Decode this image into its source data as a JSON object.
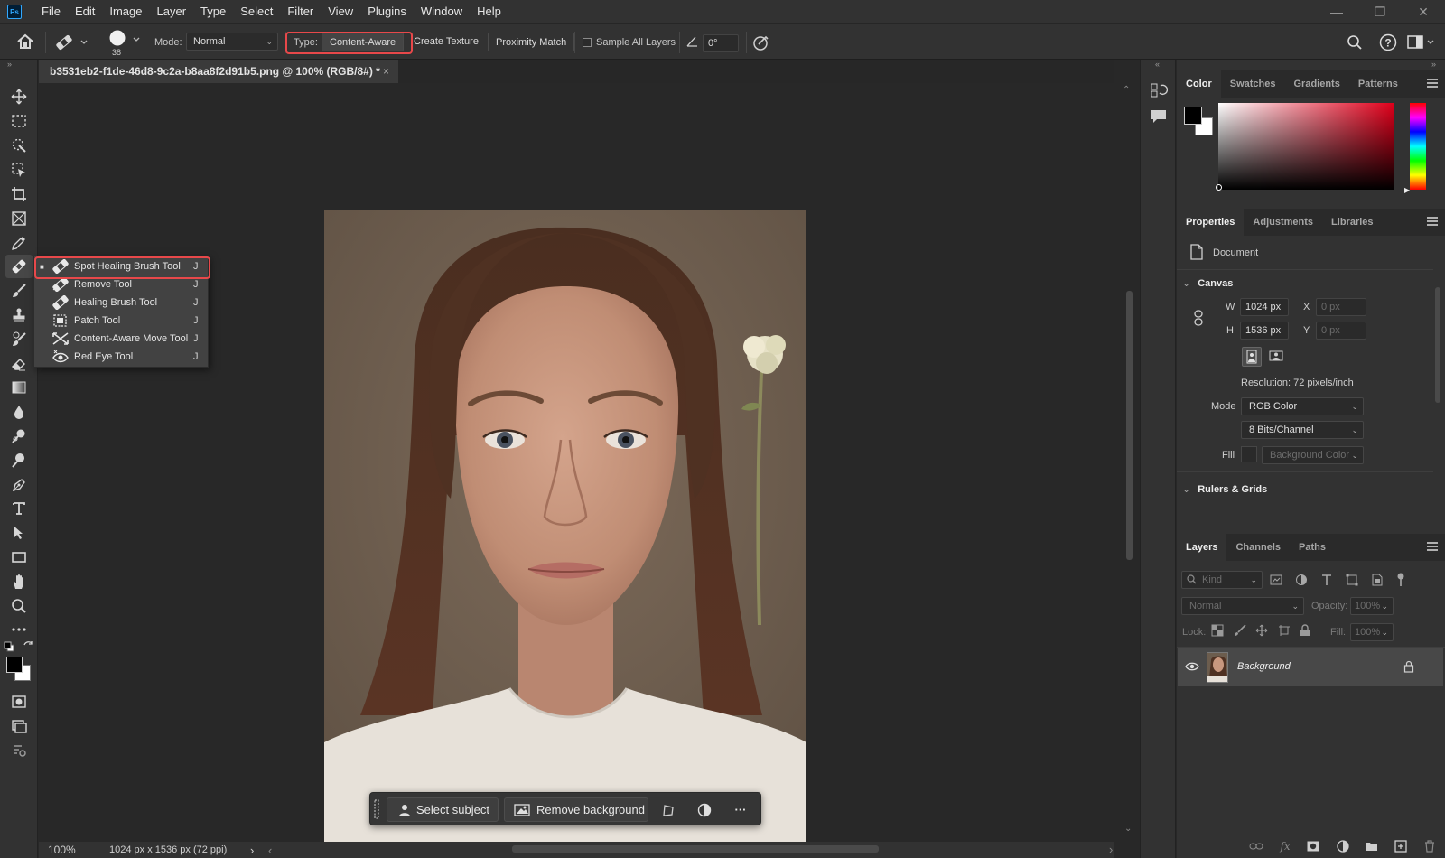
{
  "app": {
    "logo": "Ps"
  },
  "menu": [
    "File",
    "Edit",
    "Image",
    "Layer",
    "Type",
    "Select",
    "Filter",
    "View",
    "Plugins",
    "Window",
    "Help"
  ],
  "window_controls": {
    "minimize": "—",
    "restore": "❐",
    "close": "✕"
  },
  "options": {
    "brush_size": "38",
    "mode_label": "Mode:",
    "mode_value": "Normal",
    "type_label": "Type:",
    "type_content_aware": "Content-Aware",
    "type_create_texture": "Create Texture",
    "type_proximity_match": "Proximity Match",
    "sample_all_layers": "Sample All Layers",
    "angle_value": "0°"
  },
  "document": {
    "tab_title": "b3531eb2-f1de-46d8-9c2a-b8aa8f2d91b5.png @ 100% (RGB/8#) *",
    "close": "×"
  },
  "flyout": {
    "items": [
      {
        "label": "Spot Healing Brush Tool",
        "key": "J",
        "icon": "spot-healing-brush-icon",
        "active": true
      },
      {
        "label": "Remove Tool",
        "key": "J",
        "icon": "remove-tool-icon",
        "active": false
      },
      {
        "label": "Healing Brush Tool",
        "key": "J",
        "icon": "healing-brush-icon",
        "active": false
      },
      {
        "label": "Patch Tool",
        "key": "J",
        "icon": "patch-tool-icon",
        "active": false
      },
      {
        "label": "Content-Aware Move Tool",
        "key": "J",
        "icon": "content-aware-move-icon",
        "active": false
      },
      {
        "label": "Red Eye Tool",
        "key": "J",
        "icon": "red-eye-icon",
        "active": false
      }
    ],
    "active_marker": "■"
  },
  "taskbar": {
    "select_subject": "Select subject",
    "remove_background": "Remove background",
    "more": "···"
  },
  "status": {
    "zoom": "100%",
    "doc_info": "1024 px x 1536 px (72 ppi)",
    "arrow": "›",
    "scroll_left": "‹",
    "scroll_right": "›"
  },
  "color_panel": {
    "tabs": [
      "Color",
      "Swatches",
      "Gradients",
      "Patterns"
    ],
    "active_tab": 0,
    "foreground": "#000000",
    "background": "#ffffff",
    "hue_color": "#e0001b"
  },
  "properties_panel": {
    "tabs": [
      "Properties",
      "Adjustments",
      "Libraries"
    ],
    "active_tab": 0,
    "document_label": "Document",
    "canvas_header": "Canvas",
    "w_label": "W",
    "w_value": "1024 px",
    "h_label": "H",
    "h_value": "1536 px",
    "x_label": "X",
    "x_value": "0 px",
    "y_label": "Y",
    "y_value": "0 px",
    "resolution": "Resolution: 72 pixels/inch",
    "mode_label": "Mode",
    "mode_value": "RGB Color",
    "bits_value": "8 Bits/Channel",
    "fill_label": "Fill",
    "fill_value": "Background Color",
    "rulers_header": "Rulers & Grids"
  },
  "layers_panel": {
    "tabs": [
      "Layers",
      "Channels",
      "Paths"
    ],
    "active_tab": 0,
    "kind_placeholder": "Kind",
    "blend_mode": "Normal",
    "opacity_label": "Opacity:",
    "opacity_value": "100%",
    "lock_label": "Lock:",
    "fill_label": "Fill:",
    "fill_value": "100%",
    "layers": [
      {
        "name": "Background",
        "visible": true,
        "locked": true
      }
    ],
    "footer_fx": "fx"
  },
  "colors": {
    "highlight": "#e8484a",
    "accent_blue": "#31a8ff"
  }
}
